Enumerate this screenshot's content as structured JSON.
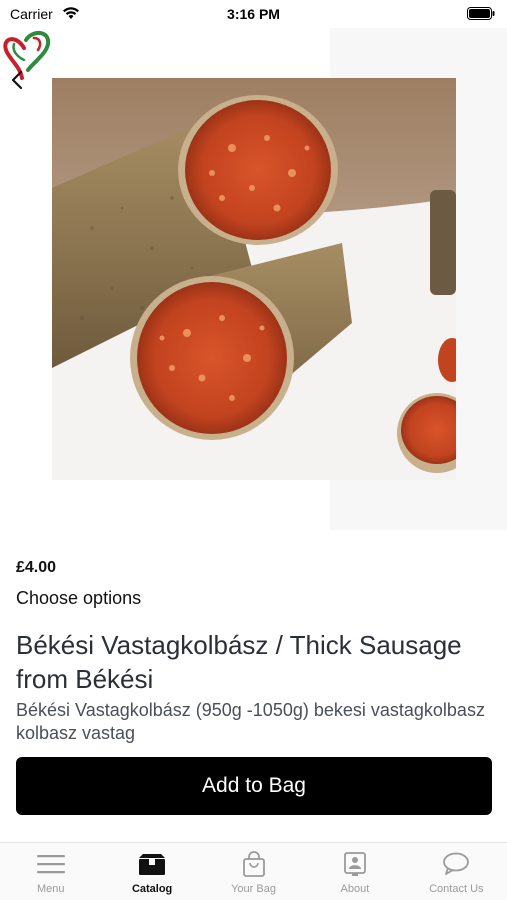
{
  "status_bar": {
    "carrier": "Carrier",
    "time": "3:16 PM"
  },
  "nav": {
    "logo_icon": "heart-logo-icon",
    "back_icon": "chevron-left-icon",
    "share_icon": "share-icon"
  },
  "product": {
    "image_icon": "sausage-photo",
    "price": "£4.00",
    "options_label": "Choose options",
    "title": "Békési Vastagkolbász / Thick Sausage from Békési",
    "description": "Békési Vastagkolbász (950g -1050g) bekesi vastagkolbasz kolbasz vastag",
    "add_to_bag_label": "Add to Bag"
  },
  "tab_bar": {
    "items": [
      {
        "label": "Menu",
        "icon": "hamburger-icon",
        "active": false
      },
      {
        "label": "Catalog",
        "icon": "catalog-box-icon",
        "active": true
      },
      {
        "label": "Your Bag",
        "icon": "bag-icon",
        "active": false
      },
      {
        "label": "About",
        "icon": "contact-card-icon",
        "active": false
      },
      {
        "label": "Contact Us",
        "icon": "chat-bubble-icon",
        "active": false
      }
    ]
  },
  "colors": {
    "accent": "#000000",
    "title_text": "#2b2f3a",
    "inactive_tab": "#9a9a9a"
  }
}
